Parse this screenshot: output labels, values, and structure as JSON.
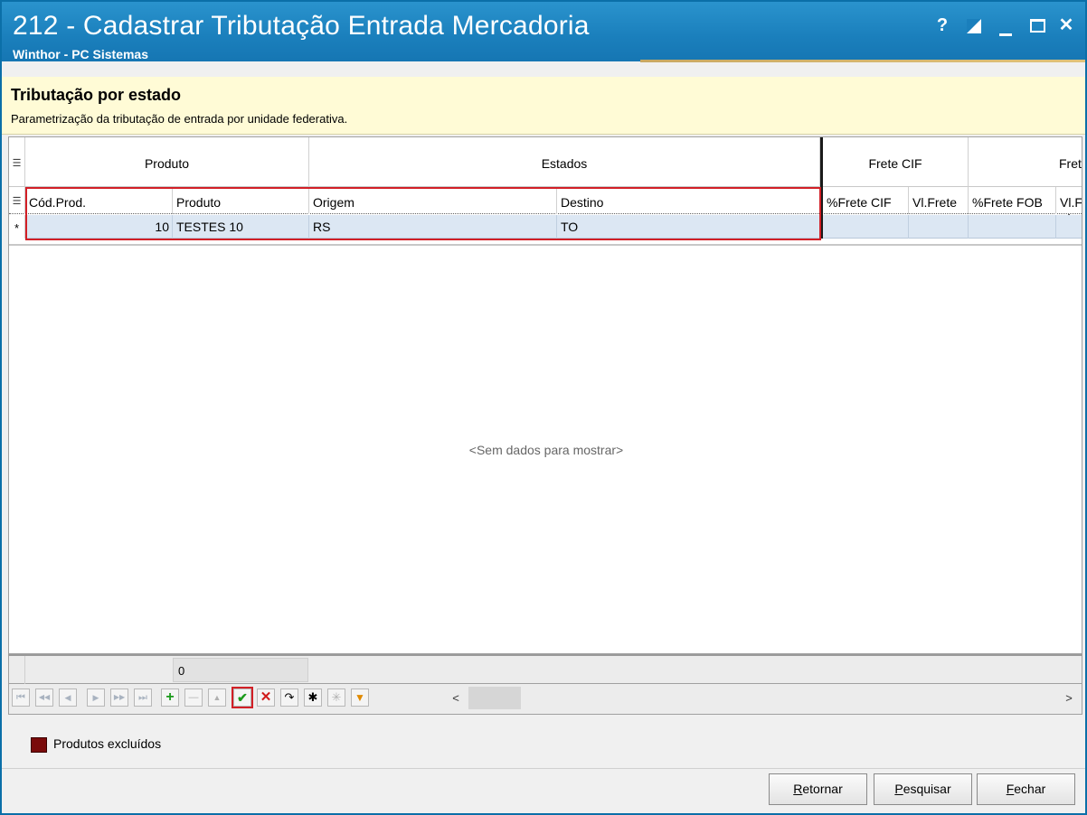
{
  "window": {
    "title": "212 - Cadastrar Tributação Entrada Mercadoria",
    "subtitle": "Winthor - PC Sistemas",
    "controls": {
      "help": "?",
      "minimize": "_",
      "close": "✕"
    }
  },
  "info": {
    "title": "Tributação por estado",
    "description": "Parametrização da tributação de entrada por unidade federativa."
  },
  "grid": {
    "bands": [
      "Produto",
      "Estados",
      "Frete CIF",
      "Frete F"
    ],
    "columns": [
      "Cód.Prod.",
      "Produto",
      "Origem",
      "Destino",
      "%Frete CIF",
      "Vl.Frete",
      "%Frete FOB",
      "Vl.F"
    ],
    "new_row_indicator": "*",
    "row": {
      "cod_prod": "10",
      "produto": "TESTES 10",
      "origem": "RS",
      "destino": "TO"
    },
    "empty_message": "<Sem dados para mostrar>",
    "summary_value": "0"
  },
  "navigator": {
    "first": "⏮",
    "prev_page": "◀◀",
    "prev": "◀",
    "next": "▶",
    "next_page": "▶▶",
    "last": "⏭",
    "add": "+",
    "remove": "—",
    "edit": "▲",
    "confirm": "✔",
    "cancel": "✕",
    "refresh": "↷",
    "bookmark": "✱",
    "goto_bookmark": "✳",
    "filter": "▼",
    "scroll_left": "<",
    "scroll_right": ">"
  },
  "legend": {
    "label": "Produtos excluídos",
    "color": "#7a0b0b"
  },
  "buttons": {
    "retornar": {
      "accel": "R",
      "rest": "etornar"
    },
    "pesquisar": {
      "accel": "P",
      "rest": "esquisar"
    },
    "fechar": {
      "accel": "F",
      "rest": "echar"
    }
  }
}
